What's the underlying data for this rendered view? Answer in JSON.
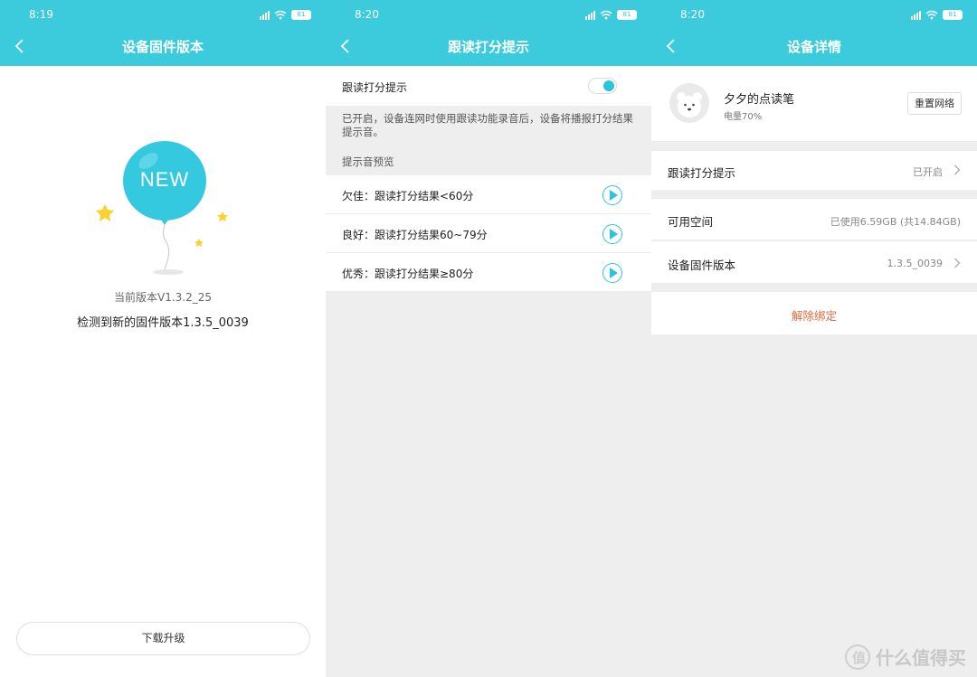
{
  "screen1": {
    "time": "8:19",
    "battery": "81",
    "title": "设备固件版本",
    "balloon_text": "NEW",
    "current_version": "当前版本V1.3.2_25",
    "new_version": "检测到新的固件版本1.3.5_0039",
    "download_button": "下载升级"
  },
  "screen2": {
    "time": "8:20",
    "battery": "81",
    "title": "跟读打分提示",
    "toggle_label": "跟读打分提示",
    "toggle_on": true,
    "description": "已开启，设备连网时使用跟读功能录音后，设备将播报打分结果提示音。",
    "section_header": "提示音预览",
    "previews": [
      {
        "label": "欠佳：跟读打分结果<60分"
      },
      {
        "label": "良好：跟读打分结果60~79分"
      },
      {
        "label": "优秀：跟读打分结果≥80分"
      }
    ]
  },
  "screen3": {
    "time": "8:20",
    "battery": "81",
    "title": "设备详情",
    "device_name": "夕夕的点读笔",
    "battery_level": "电量70%",
    "reset_button": "重置网络",
    "rows": [
      {
        "label": "跟读打分提示",
        "value": "已开启"
      },
      {
        "label": "可用空间",
        "value": "已使用6.59GB (共14.84GB)"
      },
      {
        "label": "设备固件版本",
        "value": "1.3.5_0039"
      }
    ],
    "unbind": "解除绑定"
  },
  "watermark": "什么值得买",
  "colors": {
    "header": "#3bcbdd",
    "accent": "#2ec3dd",
    "danger": "#e06a3a",
    "balloon": "#35c9e0",
    "star": "#f9d22e"
  }
}
